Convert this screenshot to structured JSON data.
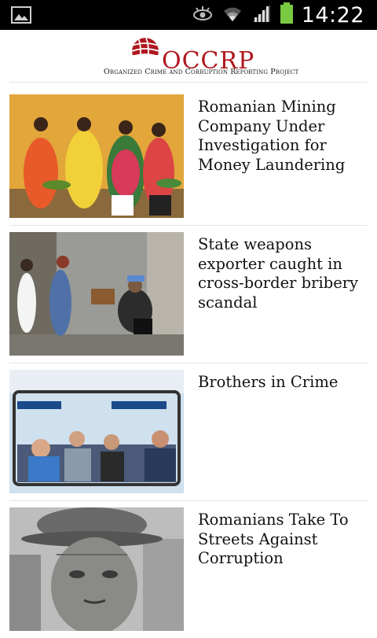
{
  "status_bar": {
    "time": "14:22",
    "icons": [
      "gallery-icon",
      "eye-icon",
      "wifi-icon",
      "signal-icon",
      "battery-icon"
    ]
  },
  "header": {
    "brand": "OCCRP",
    "tagline": "Organized Crime and Corruption Reporting Project",
    "brand_color": "#b0171f"
  },
  "articles": [
    {
      "title": "Romanian Mining Company Under Investigation for Money Laundering"
    },
    {
      "title": "State weapons exporter caught in cross-border bribery scandal"
    },
    {
      "title": "Brothers in Crime"
    },
    {
      "title": "Romanians Take To Streets Against Corruption"
    }
  ]
}
